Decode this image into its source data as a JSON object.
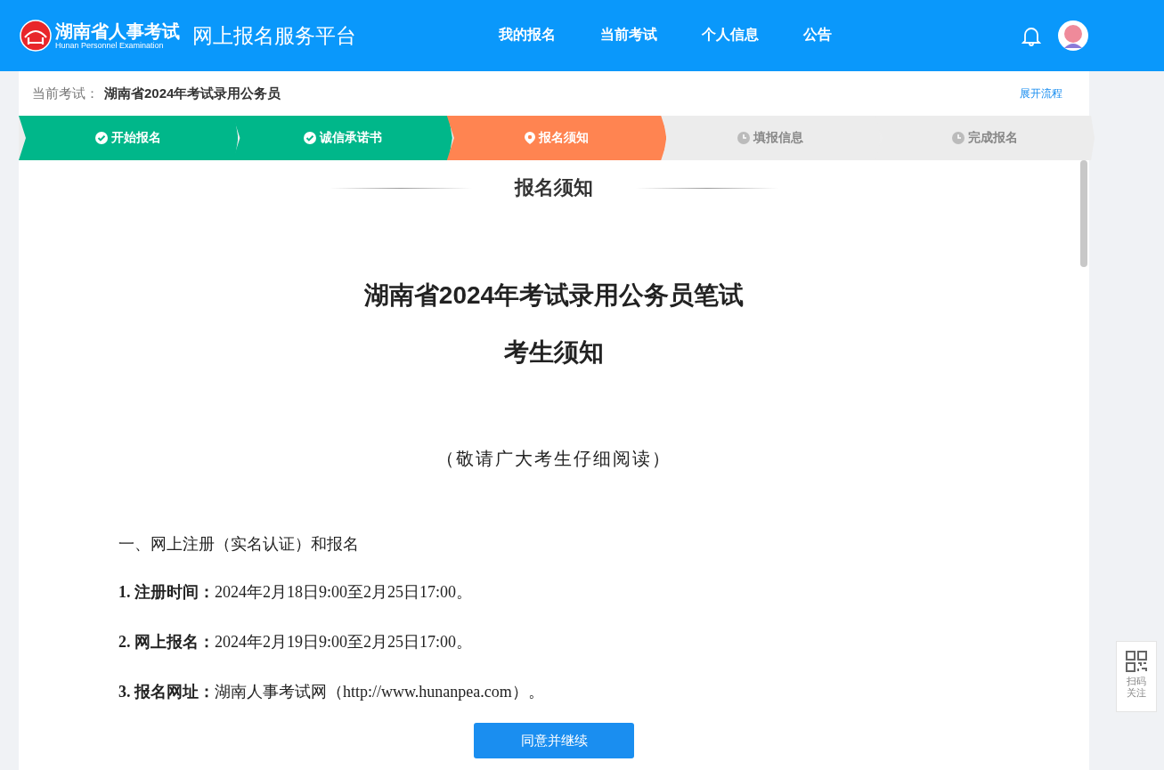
{
  "header": {
    "logo_title": "湖南省人事考试",
    "logo_subtitle": "Hunan Personnel Examination",
    "platform": "网上报名服务平台",
    "nav": [
      {
        "label": "我的报名",
        "selected": false
      },
      {
        "label": "当前考试",
        "selected": false
      },
      {
        "label": "个人信息",
        "selected": false
      },
      {
        "label": "公告",
        "selected": false
      }
    ]
  },
  "exam_bar": {
    "label": "当前考试：",
    "exam": "湖南省2024年考试录用公务员",
    "link": "展开流程"
  },
  "steps": [
    {
      "label": "开始报名",
      "kind": "done"
    },
    {
      "label": "诚信承诺书",
      "kind": "done"
    },
    {
      "label": "报名须知",
      "kind": "current"
    },
    {
      "label": "填报信息",
      "kind": "todo"
    },
    {
      "label": "完成报名",
      "kind": "todo"
    }
  ],
  "notice": {
    "heading": "报名须知",
    "title_lines": [
      "湖南省2024年考试录用公务员笔试",
      "考生须知"
    ],
    "subtitle": "（敬请广大考生仔细阅读）",
    "section": "一、网上注册（实名认证）和报名",
    "items": [
      "**1. 注册时间：**2024年2月18日9:00至2月25日17:00。",
      "**2. 网上报名：**2024年2月19日9:00至2月25日17:00。",
      "**3. 报名网址：**湖南人事考试网（http://www.hunanpea.com）。"
    ]
  },
  "agree_button": "同意并继续",
  "qr_float": {
    "label": "扫码关注"
  }
}
